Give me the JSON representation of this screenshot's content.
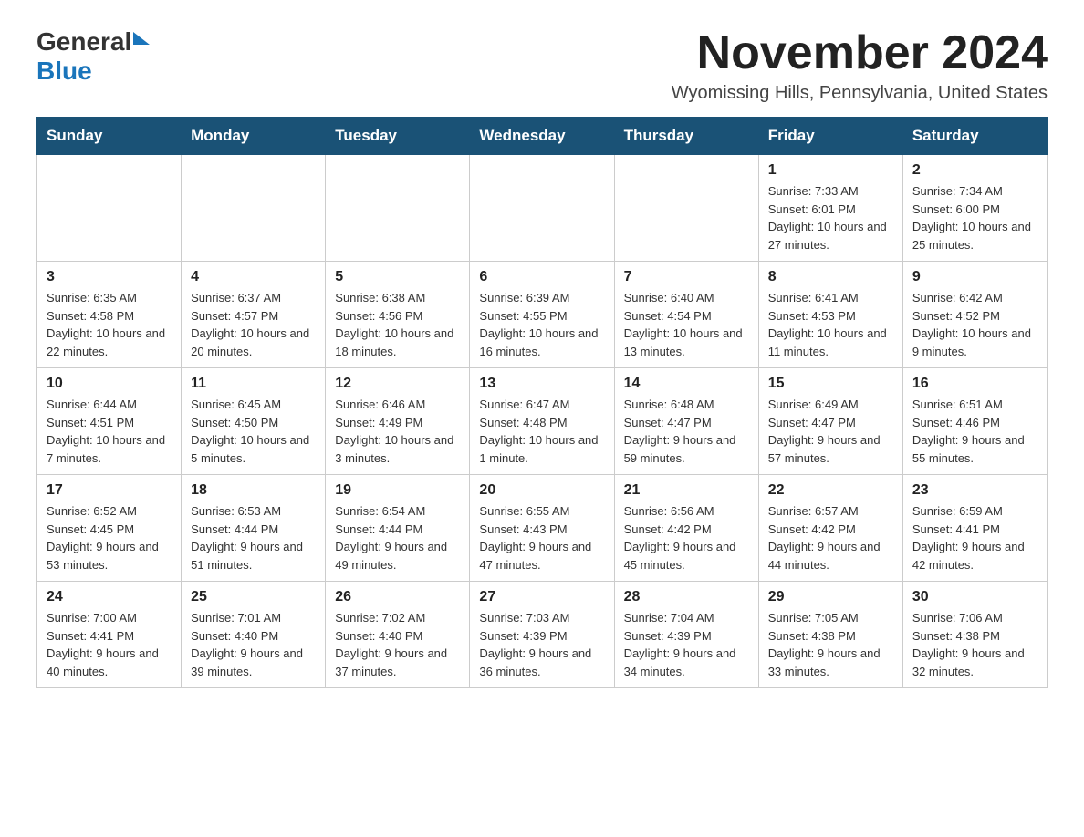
{
  "header": {
    "logo_general": "General",
    "logo_blue": "Blue",
    "month_title": "November 2024",
    "location": "Wyomissing Hills, Pennsylvania, United States"
  },
  "weekdays": [
    "Sunday",
    "Monday",
    "Tuesday",
    "Wednesday",
    "Thursday",
    "Friday",
    "Saturday"
  ],
  "weeks": [
    [
      {
        "day": "",
        "info": ""
      },
      {
        "day": "",
        "info": ""
      },
      {
        "day": "",
        "info": ""
      },
      {
        "day": "",
        "info": ""
      },
      {
        "day": "",
        "info": ""
      },
      {
        "day": "1",
        "info": "Sunrise: 7:33 AM\nSunset: 6:01 PM\nDaylight: 10 hours and 27 minutes."
      },
      {
        "day": "2",
        "info": "Sunrise: 7:34 AM\nSunset: 6:00 PM\nDaylight: 10 hours and 25 minutes."
      }
    ],
    [
      {
        "day": "3",
        "info": "Sunrise: 6:35 AM\nSunset: 4:58 PM\nDaylight: 10 hours and 22 minutes."
      },
      {
        "day": "4",
        "info": "Sunrise: 6:37 AM\nSunset: 4:57 PM\nDaylight: 10 hours and 20 minutes."
      },
      {
        "day": "5",
        "info": "Sunrise: 6:38 AM\nSunset: 4:56 PM\nDaylight: 10 hours and 18 minutes."
      },
      {
        "day": "6",
        "info": "Sunrise: 6:39 AM\nSunset: 4:55 PM\nDaylight: 10 hours and 16 minutes."
      },
      {
        "day": "7",
        "info": "Sunrise: 6:40 AM\nSunset: 4:54 PM\nDaylight: 10 hours and 13 minutes."
      },
      {
        "day": "8",
        "info": "Sunrise: 6:41 AM\nSunset: 4:53 PM\nDaylight: 10 hours and 11 minutes."
      },
      {
        "day": "9",
        "info": "Sunrise: 6:42 AM\nSunset: 4:52 PM\nDaylight: 10 hours and 9 minutes."
      }
    ],
    [
      {
        "day": "10",
        "info": "Sunrise: 6:44 AM\nSunset: 4:51 PM\nDaylight: 10 hours and 7 minutes."
      },
      {
        "day": "11",
        "info": "Sunrise: 6:45 AM\nSunset: 4:50 PM\nDaylight: 10 hours and 5 minutes."
      },
      {
        "day": "12",
        "info": "Sunrise: 6:46 AM\nSunset: 4:49 PM\nDaylight: 10 hours and 3 minutes."
      },
      {
        "day": "13",
        "info": "Sunrise: 6:47 AM\nSunset: 4:48 PM\nDaylight: 10 hours and 1 minute."
      },
      {
        "day": "14",
        "info": "Sunrise: 6:48 AM\nSunset: 4:47 PM\nDaylight: 9 hours and 59 minutes."
      },
      {
        "day": "15",
        "info": "Sunrise: 6:49 AM\nSunset: 4:47 PM\nDaylight: 9 hours and 57 minutes."
      },
      {
        "day": "16",
        "info": "Sunrise: 6:51 AM\nSunset: 4:46 PM\nDaylight: 9 hours and 55 minutes."
      }
    ],
    [
      {
        "day": "17",
        "info": "Sunrise: 6:52 AM\nSunset: 4:45 PM\nDaylight: 9 hours and 53 minutes."
      },
      {
        "day": "18",
        "info": "Sunrise: 6:53 AM\nSunset: 4:44 PM\nDaylight: 9 hours and 51 minutes."
      },
      {
        "day": "19",
        "info": "Sunrise: 6:54 AM\nSunset: 4:44 PM\nDaylight: 9 hours and 49 minutes."
      },
      {
        "day": "20",
        "info": "Sunrise: 6:55 AM\nSunset: 4:43 PM\nDaylight: 9 hours and 47 minutes."
      },
      {
        "day": "21",
        "info": "Sunrise: 6:56 AM\nSunset: 4:42 PM\nDaylight: 9 hours and 45 minutes."
      },
      {
        "day": "22",
        "info": "Sunrise: 6:57 AM\nSunset: 4:42 PM\nDaylight: 9 hours and 44 minutes."
      },
      {
        "day": "23",
        "info": "Sunrise: 6:59 AM\nSunset: 4:41 PM\nDaylight: 9 hours and 42 minutes."
      }
    ],
    [
      {
        "day": "24",
        "info": "Sunrise: 7:00 AM\nSunset: 4:41 PM\nDaylight: 9 hours and 40 minutes."
      },
      {
        "day": "25",
        "info": "Sunrise: 7:01 AM\nSunset: 4:40 PM\nDaylight: 9 hours and 39 minutes."
      },
      {
        "day": "26",
        "info": "Sunrise: 7:02 AM\nSunset: 4:40 PM\nDaylight: 9 hours and 37 minutes."
      },
      {
        "day": "27",
        "info": "Sunrise: 7:03 AM\nSunset: 4:39 PM\nDaylight: 9 hours and 36 minutes."
      },
      {
        "day": "28",
        "info": "Sunrise: 7:04 AM\nSunset: 4:39 PM\nDaylight: 9 hours and 34 minutes."
      },
      {
        "day": "29",
        "info": "Sunrise: 7:05 AM\nSunset: 4:38 PM\nDaylight: 9 hours and 33 minutes."
      },
      {
        "day": "30",
        "info": "Sunrise: 7:06 AM\nSunset: 4:38 PM\nDaylight: 9 hours and 32 minutes."
      }
    ]
  ]
}
